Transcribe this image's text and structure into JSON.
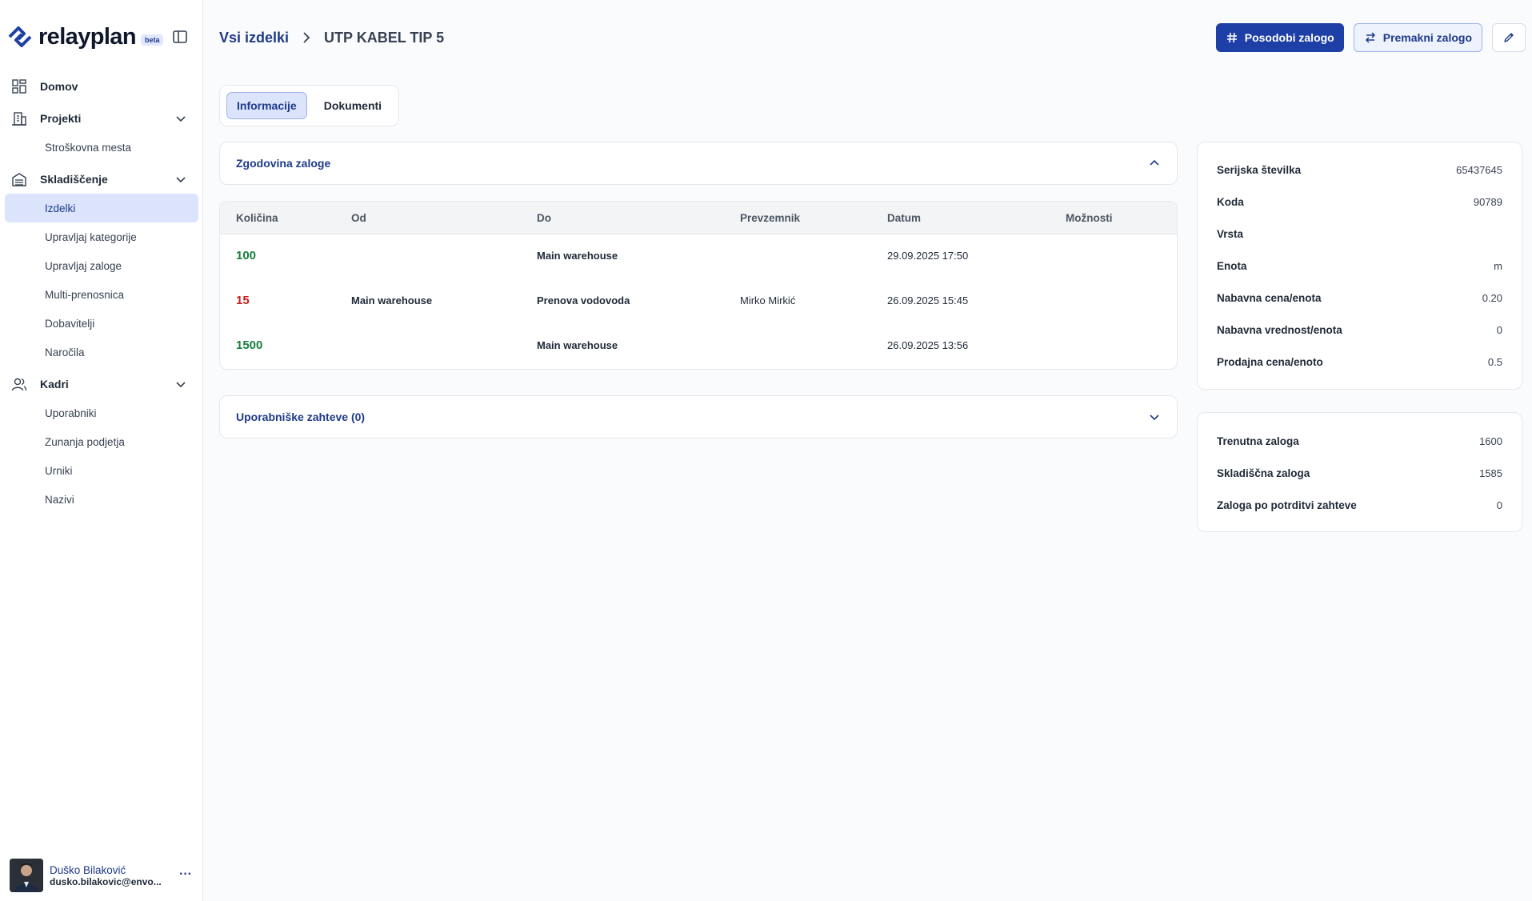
{
  "brand": {
    "name": "relayplan",
    "badge": "beta"
  },
  "sidebar": {
    "sections": [
      {
        "label": "Domov",
        "icon": "dashboard-icon"
      },
      {
        "label": "Projekti",
        "icon": "building-icon",
        "items": [
          "Stroškovna mesta"
        ]
      },
      {
        "label": "Skladiščenje",
        "icon": "warehouse-icon",
        "items": [
          "Izdelki",
          "Upravljaj kategorije",
          "Upravljaj zaloge",
          "Multi-prenosnica",
          "Dobavitelji",
          "Naročila"
        ],
        "active_item": "Izdelki"
      },
      {
        "label": "Kadri",
        "icon": "users-icon",
        "items": [
          "Uporabniki",
          "Zunanja podjetja",
          "Urniki",
          "Nazivi"
        ]
      }
    ]
  },
  "user": {
    "name": "Duško Bilaković",
    "email": "dusko.bilakovic@envo..."
  },
  "breadcrumb": {
    "parent": "Vsi izdelki",
    "current": "UTP KABEL TIP 5"
  },
  "actions": {
    "update_stock": "Posodobi zalogo",
    "move_stock": "Premakni zalogo"
  },
  "tabs": [
    "Informacije",
    "Dokumenti"
  ],
  "history": {
    "title": "Zgodovina zaloge",
    "columns": [
      "Količina",
      "Od",
      "Do",
      "Prevzemnik",
      "Datum",
      "Možnosti"
    ],
    "rows": [
      {
        "qty": "100",
        "from": "",
        "to": "Main warehouse",
        "receiver": "",
        "date": "29.09.2025 17:50"
      },
      {
        "qty": "15",
        "from": "Main warehouse",
        "to": "Prenova vodovoda",
        "receiver": "Mirko Mirkić",
        "date": "26.09.2025 15:45"
      },
      {
        "qty": "1500",
        "from": "",
        "to": "Main warehouse",
        "receiver": "",
        "date": "26.09.2025 13:56"
      }
    ]
  },
  "requests": {
    "title": "Uporabniške zahteve (0)"
  },
  "details": [
    {
      "label": "Serijska številka",
      "value": "65437645"
    },
    {
      "label": "Koda",
      "value": "90789"
    },
    {
      "label": "Vrsta",
      "value": ""
    },
    {
      "label": "Enota",
      "value": "m"
    },
    {
      "label": "Nabavna cena/enota",
      "value": "0.20"
    },
    {
      "label": "Nabavna vrednost/enota",
      "value": "0"
    },
    {
      "label": "Prodajna cena/enoto",
      "value": "0.5"
    }
  ],
  "stock": [
    {
      "label": "Trenutna zaloga",
      "value": "1600"
    },
    {
      "label": "Skladiščna zaloga",
      "value": "1585"
    },
    {
      "label": "Zaloga po potrditvi zahteve",
      "value": "0"
    }
  ],
  "colors": {
    "accent": "#1e3fa6",
    "active_bg": "#dbe4fb",
    "qty_in": "#15803d",
    "qty_out": "#c81e1e"
  }
}
